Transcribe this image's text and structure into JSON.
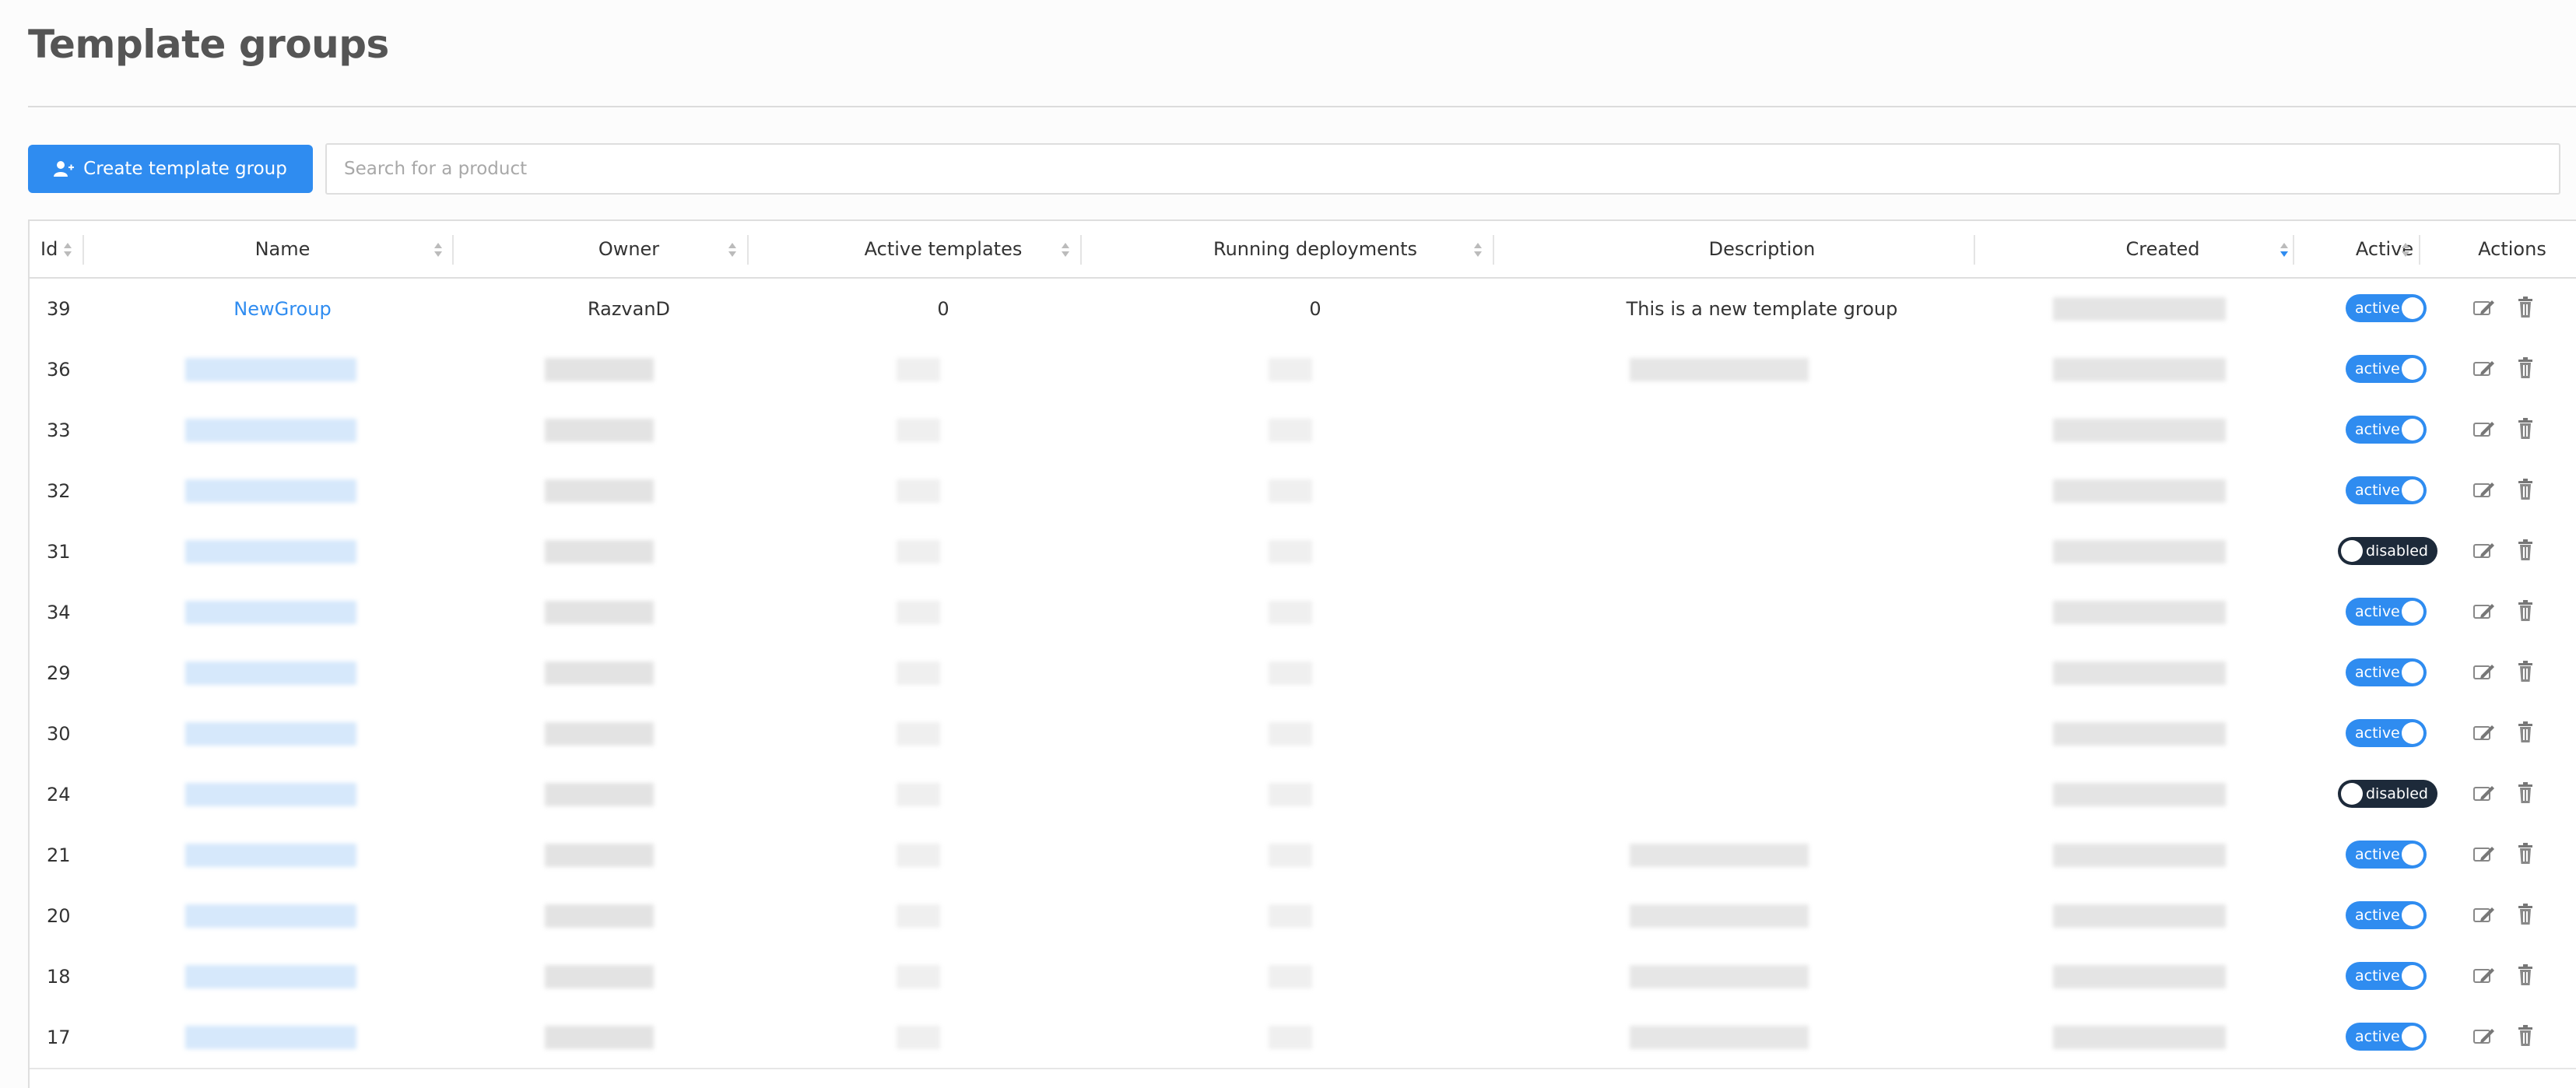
{
  "page": {
    "title": "Template groups"
  },
  "toolbar": {
    "create_label": "Create template group",
    "search_placeholder": "Search for a product"
  },
  "table": {
    "columns": [
      "Id",
      "Name",
      "Owner",
      "Active templates",
      "Running deployments",
      "Description",
      "Created",
      "Active",
      "Actions"
    ],
    "rows": [
      {
        "id": "39",
        "name": "NewGroup",
        "owner": "RazvanD",
        "active_templates": "0",
        "running_deployments": "0",
        "description": "This is a new template group",
        "status": "active"
      },
      {
        "id": "36",
        "status": "active"
      },
      {
        "id": "33",
        "status": "active"
      },
      {
        "id": "32",
        "status": "active"
      },
      {
        "id": "31",
        "status": "disabled"
      },
      {
        "id": "34",
        "status": "active"
      },
      {
        "id": "29",
        "status": "active"
      },
      {
        "id": "30",
        "status": "active"
      },
      {
        "id": "24",
        "status": "disabled"
      },
      {
        "id": "21",
        "status": "active"
      },
      {
        "id": "20",
        "status": "active"
      },
      {
        "id": "18",
        "status": "active"
      },
      {
        "id": "17",
        "status": "active"
      }
    ]
  },
  "colors": {
    "accent": "#2f8cf0",
    "disabled_toggle": "#1d2a3a",
    "border": "#dedede"
  },
  "icons": {
    "create": "user-plus-icon",
    "edit": "edit-icon",
    "delete": "trash-icon",
    "sort": "sort-icon"
  }
}
